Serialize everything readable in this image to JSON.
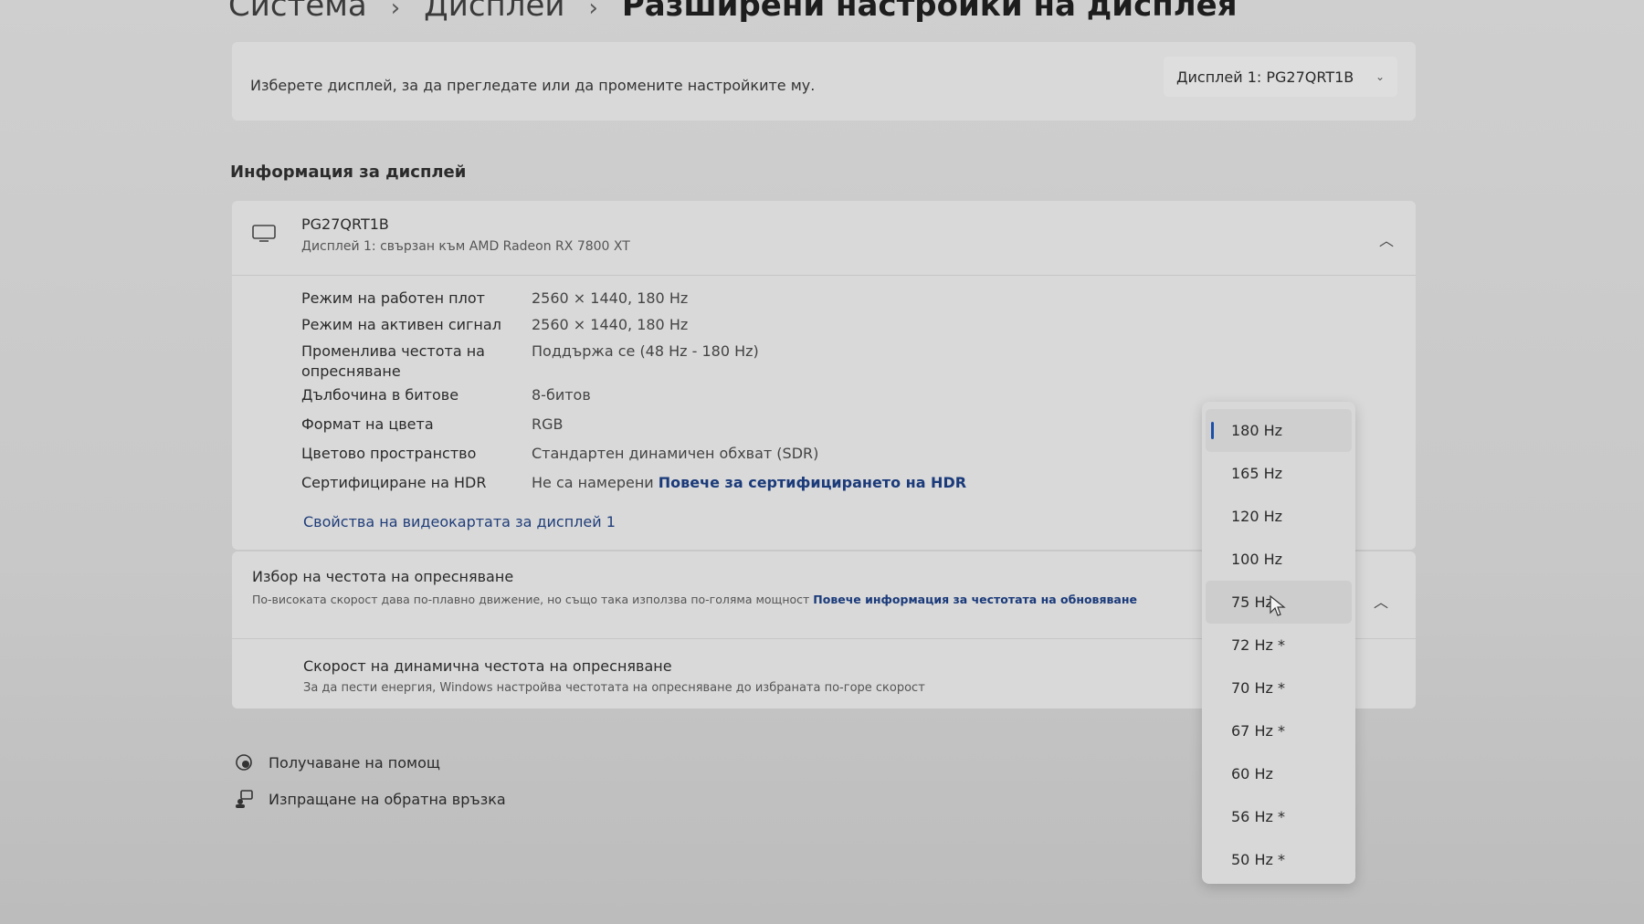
{
  "breadcrumb": {
    "item1": "Система",
    "item2": "Дисплей",
    "current": "Разширени настройки на дисплея"
  },
  "select_display": {
    "label": "Изберете дисплей, за да прегледате или да промените настройките му.",
    "value": "Дисплей 1: PG27QRT1B"
  },
  "display_info": {
    "section_title": "Информация за дисплей",
    "name": "PG27QRT1B",
    "subtitle": "Дисплей 1: свързан към AMD Radeon RX 7800 XT",
    "properties": [
      {
        "key": "Режим на работен плот",
        "value": "2560 × 1440, 180 Hz"
      },
      {
        "key": "Режим на активен сигнал",
        "value": "2560 × 1440, 180 Hz"
      },
      {
        "key": "Променлива честота на опресняване",
        "value": "Поддържа се (48 Hz - 180 Hz)"
      },
      {
        "key": "Дълбочина в битове",
        "value": "8-битов"
      },
      {
        "key": "Формат на цвета",
        "value": "RGB"
      },
      {
        "key": "Цветово пространство",
        "value": "Стандартен динамичен обхват (SDR)"
      },
      {
        "key": "Сертифициране на HDR",
        "value": "Не са намерени",
        "link": "Повече за сертифицирането на HDR"
      }
    ],
    "gpu_link": "Свойства на видеокартата за дисплей 1"
  },
  "refresh": {
    "title": "Избор на честота на опресняване",
    "description": "По-високата скорост дава по-плавно движение, но също така използва по-голяма мощност",
    "link": "Повече информация за честотата на обновяване",
    "dynamic_title": "Скорост на динамична честота на опресняване",
    "dynamic_description": "За да пести енергия, Windows настройва честотата на опресняване до избраната по-горе скорост"
  },
  "dropdown": {
    "options": [
      "180 Hz",
      "165 Hz",
      "120 Hz",
      "100 Hz",
      "75 Hz",
      "72 Hz *",
      "70 Hz *",
      "67 Hz *",
      "60 Hz",
      "56 Hz *",
      "50 Hz *"
    ],
    "selected": "180 Hz",
    "hovered": "75 Hz"
  },
  "footer": {
    "help": "Получаване на помощ",
    "feedback": "Изпращане на обратна връзка"
  },
  "colors": {
    "accent": "#1c4fa8",
    "link": "#1a3a7a"
  }
}
